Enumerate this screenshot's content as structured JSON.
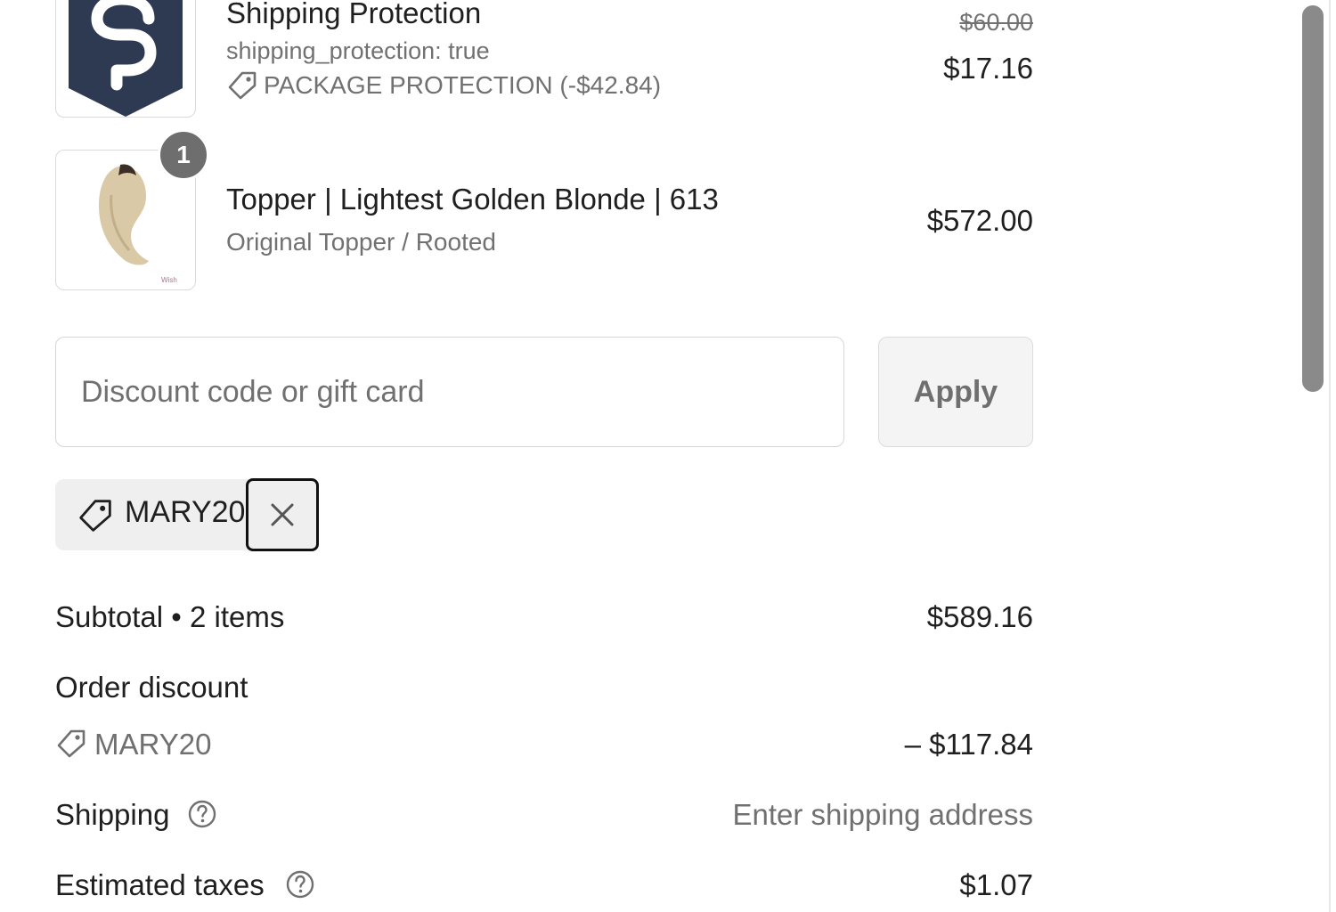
{
  "items": [
    {
      "title": "Shipping Protection",
      "property": "shipping_protection: true",
      "discount_label": "PACKAGE PROTECTION (-$42.84)",
      "original_price": "$60.00",
      "price": "$17.16",
      "icon": "shipping-protection-logo"
    },
    {
      "title": "Topper | Lightest Golden Blonde | 613",
      "variant": "Original Topper / Rooted",
      "price": "$572.00",
      "quantity": "1",
      "icon": "hair-topper-image"
    }
  ],
  "discount": {
    "placeholder": "Discount code or gift card",
    "value": "",
    "apply_label": "Apply",
    "applied_code": "MARY20"
  },
  "summary": {
    "subtotal_label": "Subtotal • 2 items",
    "subtotal_value": "$589.16",
    "order_discount_label": "Order discount",
    "order_discount_code": "MARY20",
    "order_discount_value": "– $117.84",
    "shipping_label": "Shipping",
    "shipping_value": "Enter shipping address",
    "taxes_label": "Estimated taxes",
    "taxes_value": "$1.07"
  },
  "colors": {
    "logo_navy": "#2d3a52",
    "badge": "#6e6e6e",
    "muted_text": "#717171"
  }
}
